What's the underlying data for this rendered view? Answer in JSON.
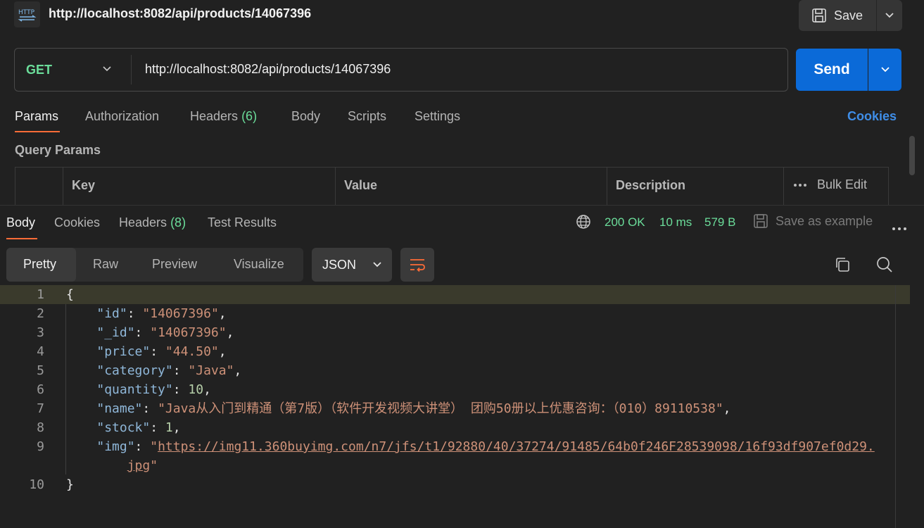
{
  "topbar": {
    "icon_text": "HTTP",
    "title": "http://localhost:8082/api/products/14067396",
    "save_label": "Save"
  },
  "request": {
    "method": "GET",
    "url": "http://localhost:8082/api/products/14067396",
    "send_label": "Send"
  },
  "req_tabs": {
    "params": "Params",
    "authorization": "Authorization",
    "headers": "Headers",
    "headers_count": "(6)",
    "body": "Body",
    "scripts": "Scripts",
    "settings": "Settings",
    "cookies": "Cookies"
  },
  "query_params": {
    "label": "Query Params",
    "col_key": "Key",
    "col_value": "Value",
    "col_description": "Description",
    "bulk_edit": "Bulk Edit"
  },
  "res_tabs": {
    "body": "Body",
    "cookies": "Cookies",
    "headers": "Headers",
    "headers_count": "(8)",
    "test_results": "Test Results"
  },
  "status": {
    "code": "200 OK",
    "time": "10 ms",
    "size": "579 B",
    "save_example": "Save as example"
  },
  "view": {
    "pretty": "Pretty",
    "raw": "Raw",
    "preview": "Preview",
    "visualize": "Visualize",
    "format": "JSON"
  },
  "code": {
    "line_numbers": [
      "1",
      "2",
      "3",
      "4",
      "5",
      "6",
      "7",
      "8",
      "9",
      "10"
    ],
    "open_brace": "{",
    "close_brace": "}",
    "id_key": "\"id\"",
    "id_val": "\"14067396\"",
    "_id_key": "\"_id\"",
    "_id_val": "\"14067396\"",
    "price_key": "\"price\"",
    "price_val": "\"44.50\"",
    "category_key": "\"category\"",
    "category_val": "\"Java\"",
    "quantity_key": "\"quantity\"",
    "quantity_val": "10",
    "name_key": "\"name\"",
    "name_val": "\"Java从入门到精通（第7版）（软件开发视频大讲堂） 团购50册以上优惠咨询：（010）89110538\"",
    "stock_key": "\"stock\"",
    "stock_val": "1",
    "img_key": "\"img\"",
    "img_url_part1": "https://img11.360buyimg.com/n7/jfs/t1/92880/40/37274/91485/64b0f246F28539098/16f93df907ef0d29.",
    "img_url_part2": "jpg"
  },
  "colors": {
    "accent": "#ff6c37",
    "send": "#0b6ad8",
    "ok": "#6bdd9a",
    "link": "#3f8ee8"
  }
}
